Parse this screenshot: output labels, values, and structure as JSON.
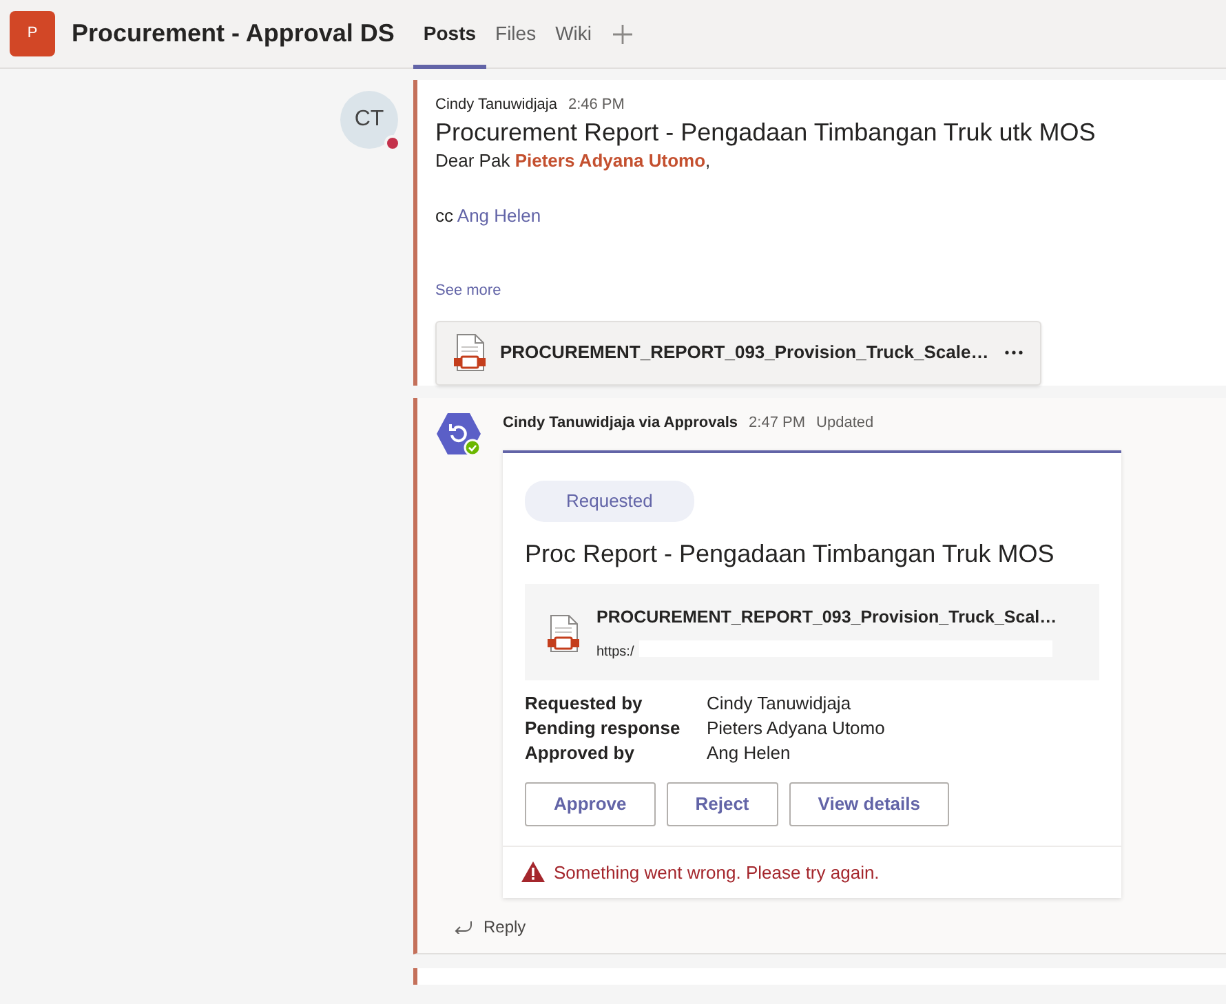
{
  "header": {
    "team_initial": "P",
    "title": "Procurement - Approval DS",
    "tabs": [
      {
        "label": "Posts",
        "selected": true
      },
      {
        "label": "Files",
        "selected": false
      },
      {
        "label": "Wiki",
        "selected": false
      }
    ]
  },
  "message": {
    "avatar_initials": "CT",
    "author": "Cindy Tanuwidjaja",
    "time": "2:46 PM",
    "subject": "Procurement Report - Pengadaan Timbangan Truk utk MOS",
    "greeting": {
      "prefix": "Dear Pak",
      "mention": "Pieters Adyana Utomo",
      "suffix": ","
    },
    "cc": {
      "prefix": "cc",
      "mention": "Ang Helen"
    },
    "see_more": "See more",
    "attachment": {
      "name": "PROCUREMENT_REPORT_093_Provision_Truck_Scale…"
    }
  },
  "reply": {
    "author": "Cindy Tanuwidjaja via Approvals",
    "time": "2:47 PM",
    "status": "Updated",
    "card": {
      "status": "Requested",
      "title": "Proc Report - Pengadaan Timbangan Truk MOS",
      "file": {
        "name": "PROCUREMENT_REPORT_093_Provision_Truck_Scal…",
        "url": "https:/"
      },
      "fields": [
        {
          "label": "Requested by",
          "value": "Cindy Tanuwidjaja"
        },
        {
          "label": "Pending response",
          "value": "Pieters Adyana Utomo"
        },
        {
          "label": "Approved by",
          "value": "Ang Helen"
        }
      ],
      "buttons": [
        "Approve",
        "Reject",
        "View details"
      ],
      "error": "Something went wrong. Please try again."
    },
    "reply_label": "Reply"
  }
}
